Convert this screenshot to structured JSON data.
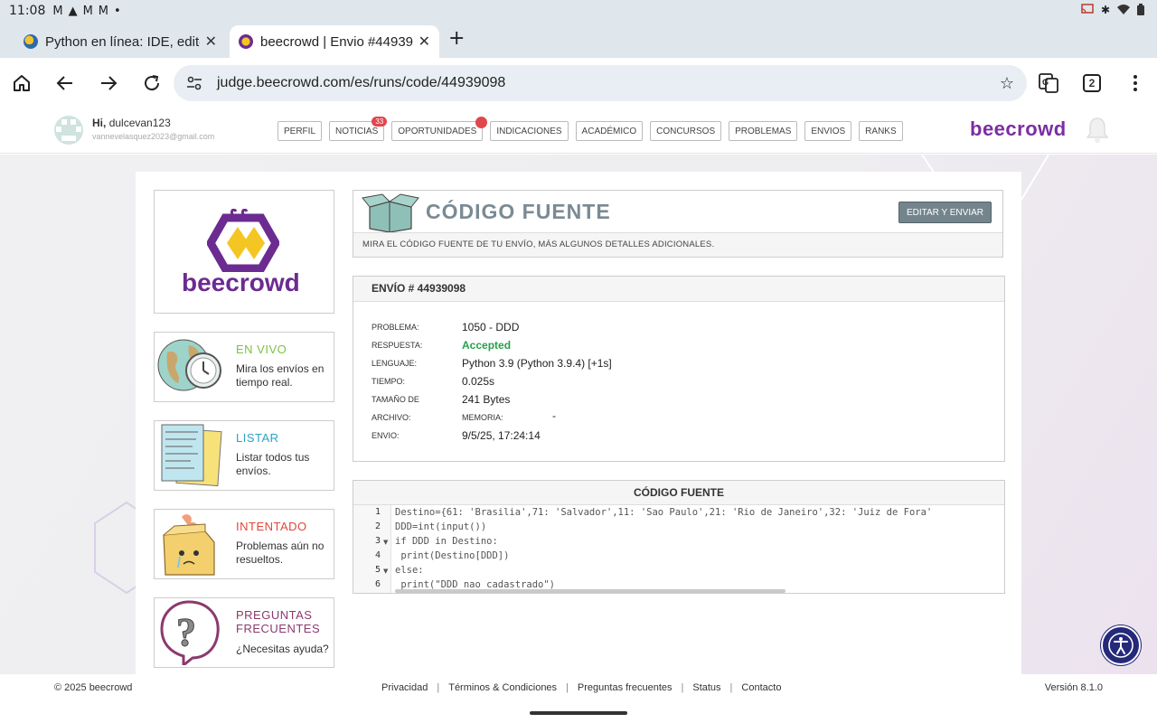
{
  "status_bar": {
    "time": "11:08",
    "icons": [
      "gmail-icon",
      "alert-icon",
      "gmail-icon",
      "gmail-icon",
      "dot-icon"
    ],
    "right_icons": [
      "cast-icon",
      "bluetooth-icon",
      "wifi-icon",
      "battery-icon"
    ]
  },
  "browser": {
    "tabs": [
      {
        "title": "Python en línea: IDE, editor",
        "active": false
      },
      {
        "title": "beecrowd | Envio #44939098",
        "active": true
      }
    ],
    "url": "judge.beecrowd.com/es/runs/code/44939098",
    "tab_count": "2"
  },
  "header": {
    "greeting": "Hi,",
    "username": "dulcevan123",
    "email": "vannevelasquez2023@gmail.com",
    "nav": [
      {
        "label": "PERFIL"
      },
      {
        "label": "NOTICIAS",
        "badge": "33"
      },
      {
        "label": "OPORTUNIDADES",
        "dot": true
      },
      {
        "label": "INDICACIONES"
      },
      {
        "label": "ACADÉMICO"
      },
      {
        "label": "CONCURSOS"
      },
      {
        "label": "PROBLEMAS"
      },
      {
        "label": "ENVIOS"
      },
      {
        "label": "RANKS"
      }
    ],
    "brand": "beecrowd"
  },
  "sidebar": {
    "logo_text": "beecrowd",
    "cards": [
      {
        "title": "EN VIVO",
        "desc": "Mira los envíos en tiempo real.",
        "color": "#7cc242"
      },
      {
        "title": "LISTAR",
        "desc": "Listar todos tus envíos.",
        "color": "#2aa3c6"
      },
      {
        "title": "INTENTADO",
        "desc": "Problemas aún no resueltos.",
        "color": "#e0473a"
      },
      {
        "title": "PREGUNTAS FRECUENTES",
        "desc": "¿Necesitas ayuda?",
        "color": "#8b3a6e"
      }
    ]
  },
  "source_header": {
    "title": "CÓDIGO FUENTE",
    "edit_button": "EDITAR Y ENVIAR",
    "subtitle": "MIRA EL CÓDIGO FUENTE DE TU ENVÍO, MÁS ALGUNOS DETALLES ADICIONALES."
  },
  "submission": {
    "title": "ENVÍO # 44939098",
    "rows": [
      {
        "label": "PROBLEMA:",
        "value": "1050 - DDD"
      },
      {
        "label": "RESPUESTA:",
        "value": "Accepted"
      },
      {
        "label": "LENGUAJE:",
        "value": "Python 3.9 (Python 3.9.4) [+1s]"
      },
      {
        "label": "TIEMPO:",
        "value": "0.025s"
      },
      {
        "label": "TAMAÑO DE",
        "value": "241 Bytes"
      },
      {
        "label": "ARCHIVO:",
        "label2": "MEMORIA:",
        "value2": "-"
      },
      {
        "label": "ENVIO:",
        "value": "9/5/25, 17:24:14"
      }
    ],
    "accepted_color": "#27a04a"
  },
  "code": {
    "title": "CÓDIGO FUENTE",
    "line_numbers": [
      "1",
      "2",
      "3",
      "4",
      "5",
      "6"
    ],
    "lines": [
      "Destino={61: 'Brasilia',71: 'Salvador',11: 'Sao Paulo',21: 'Rio de Janeiro',32: 'Juiz de Fora'",
      "DDD=int(input())",
      "if DDD in Destino:",
      " print(Destino[DDD])",
      "else:",
      " print(\"DDD nao cadastrado\")"
    ]
  },
  "footer": {
    "copyright": "© 2025 beecrowd",
    "links": [
      "Privacidad",
      "Términos & Condiciones",
      "Preguntas frecuentes",
      "Status",
      "Contacto"
    ],
    "version": "Versión 8.1.0"
  },
  "colors": {
    "brand_purple": "#7b2ea3",
    "edit_button": "#74848d",
    "a11y_button": "#25297a"
  }
}
